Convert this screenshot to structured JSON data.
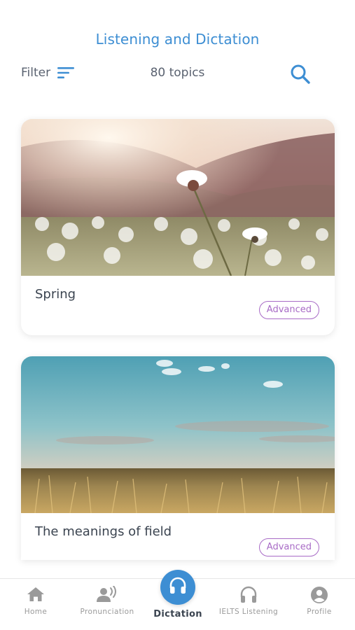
{
  "header": {
    "title": "Listening and Dictation",
    "filter_label": "Filter",
    "topic_count": "80 topics"
  },
  "icons": {
    "filter": "filter-lines-icon",
    "search": "search-icon"
  },
  "colors": {
    "accent": "#3d8ed3",
    "badge": "#a86bc6",
    "title_text": "#3b4450",
    "muted": "#9a9a9a"
  },
  "topics": [
    {
      "title": "Spring",
      "level": "Advanced",
      "image": "field-of-white-flowers-at-sunset"
    },
    {
      "title": "The meanings of field",
      "level": "Advanced",
      "image": "wheat-field-under-blue-sky"
    }
  ],
  "nav": {
    "items": [
      {
        "label": "Home",
        "icon": "home-icon"
      },
      {
        "label": "Pronunciation",
        "icon": "speaker-person-icon"
      },
      {
        "label": "Dictation",
        "icon": "headphones-icon",
        "active": true
      },
      {
        "label": "IELTS Listening",
        "icon": "headphones-outline-icon"
      },
      {
        "label": "Profile",
        "icon": "profile-icon"
      }
    ]
  }
}
